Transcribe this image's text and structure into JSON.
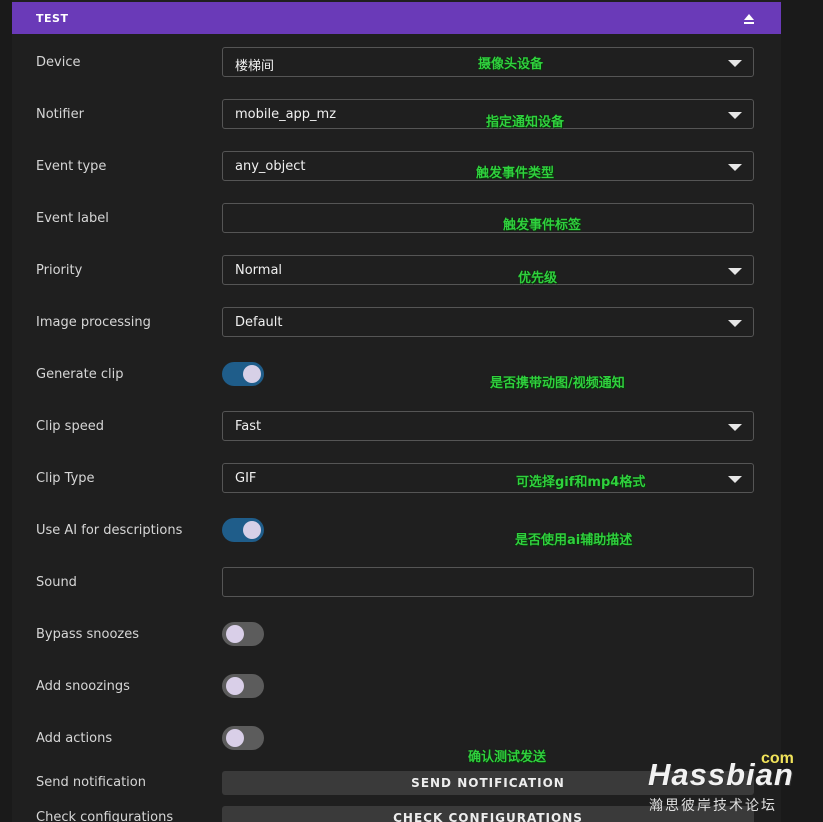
{
  "header": {
    "title": "TEST"
  },
  "rows": [
    {
      "label": "Device",
      "value": "楼梯间",
      "note": "摄像头设备"
    },
    {
      "label": "Notifier",
      "value": "mobile_app_mz",
      "note": "指定通知设备"
    },
    {
      "label": "Event type",
      "value": "any_object",
      "note": "触发事件类型"
    },
    {
      "label": "Event label",
      "value": "",
      "note": "触发事件标签"
    },
    {
      "label": "Priority",
      "value": "Normal",
      "note": "优先级"
    },
    {
      "label": "Image processing",
      "value": "Default",
      "note": ""
    },
    {
      "label": "Generate clip",
      "toggle": true,
      "note": "是否携带动图/视频通知"
    },
    {
      "label": "Clip speed",
      "value": "Fast",
      "note": ""
    },
    {
      "label": "Clip Type",
      "value": "GIF",
      "note": "可选择gif和mp4格式"
    },
    {
      "label": "Use AI for descriptions",
      "toggle": true,
      "note": "是否使用ai辅助描述"
    },
    {
      "label": "Sound",
      "value": "",
      "note": ""
    },
    {
      "label": "Bypass snoozes",
      "toggle": false
    },
    {
      "label": "Add snoozings",
      "toggle": false
    },
    {
      "label": "Add actions",
      "toggle": false,
      "note": "确认测试发送"
    },
    {
      "label": "Send notification",
      "button": "SEND NOTIFICATION"
    },
    {
      "label": "Check configurations",
      "button": "CHECK CONFIGURATIONS"
    }
  ],
  "watermark": {
    "com": "com",
    "main": "Hassbian",
    "sub": "瀚思彼岸技术论坛"
  },
  "colors": {
    "header": "#6a3ab8",
    "toggle_on": "#1f5d8a",
    "toggle_off": "#5c5c5c",
    "annotation": "#2fd13d"
  }
}
